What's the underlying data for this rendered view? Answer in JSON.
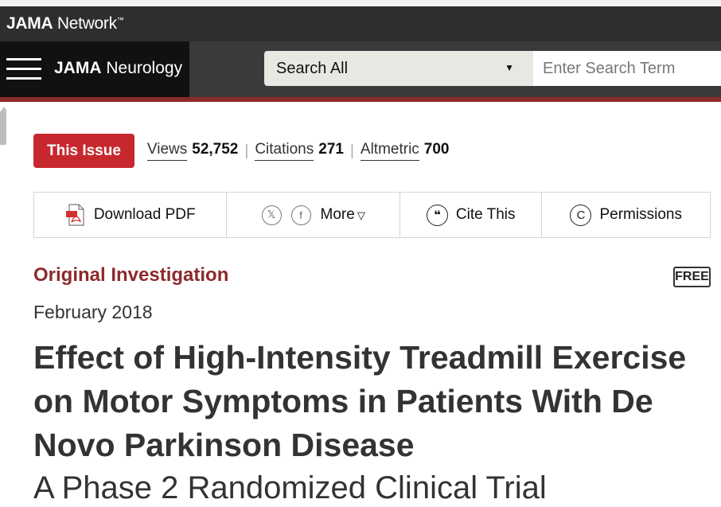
{
  "network": {
    "brand_bold": "JAMA",
    "brand_rest": " Network",
    "trademark": "™"
  },
  "journal": {
    "brand_bold": "JAMA",
    "brand_rest": " Neurology"
  },
  "search": {
    "scope": "Search All",
    "placeholder": "Enter Search Term"
  },
  "metrics": {
    "issue_badge": "This Issue",
    "views_label": "Views",
    "views_value": "52,752",
    "citations_label": "Citations",
    "citations_value": "271",
    "altmetric_label": "Altmetric",
    "altmetric_value": "700"
  },
  "toolbar": {
    "download_pdf": "Download PDF",
    "share_x": "𝕏",
    "share_facebook": "f",
    "more": "More",
    "cite_glyph": "❝",
    "cite": "Cite This",
    "permissions_glyph": "C",
    "permissions": "Permissions"
  },
  "article": {
    "type": "Original Investigation",
    "free_badge": "FREE",
    "date": "February 2018",
    "title": "Effect of High-Intensity Treadmill Exercise on Motor Symptoms in Patients With De Novo Parkinson Disease",
    "subtitle": "A Phase 2 Randomized Clinical Trial"
  },
  "colors": {
    "accent_red": "#c7282e",
    "journal_maroon": "#8c2b2b",
    "dark_bar": "#2e2e2e"
  }
}
